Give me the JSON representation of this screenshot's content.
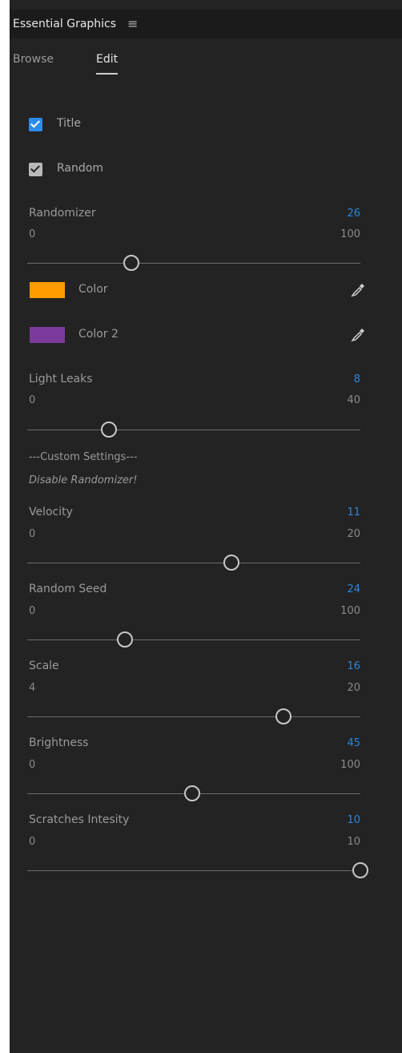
{
  "header": {
    "title": "Essential Graphics",
    "menu_icon": "hamburger-icon"
  },
  "tabs": [
    {
      "label": "Browse"
    },
    {
      "label": "Edit"
    }
  ],
  "checkboxes": {
    "title": {
      "label": "Title",
      "checked": true,
      "color": "#2d8ceb"
    },
    "random": {
      "label": "Random",
      "checked": true,
      "color": "#b8b8b8"
    }
  },
  "sliders": {
    "randomizer": {
      "label": "Randomizer",
      "value": "26",
      "min": "0",
      "max": "100"
    },
    "light_leaks": {
      "label": "Light Leaks",
      "value": "8",
      "min": "0",
      "max": "40"
    },
    "velocity": {
      "label": "Velocity",
      "value": "11",
      "min": "0",
      "max": "20"
    },
    "random_seed": {
      "label": "Random Seed",
      "value": "24",
      "min": "0",
      "max": "100"
    },
    "scale": {
      "label": "Scale",
      "value": "16",
      "min": "4",
      "max": "20"
    },
    "brightness": {
      "label": "Brightness",
      "value": "45",
      "min": "0",
      "max": "100"
    },
    "scratches": {
      "label": "Scratches Intesity",
      "value": "10",
      "min": "0",
      "max": "10"
    }
  },
  "colors": {
    "color1": {
      "label": "Color",
      "swatch": "#ff9c00",
      "icon": "eyedropper-icon"
    },
    "color2": {
      "label": "Color 2",
      "swatch": "#7b3a9c",
      "icon": "eyedropper-icon"
    }
  },
  "custom_settings": {
    "heading": "---Custom Settings---",
    "note": "Disable Randomizer!"
  }
}
